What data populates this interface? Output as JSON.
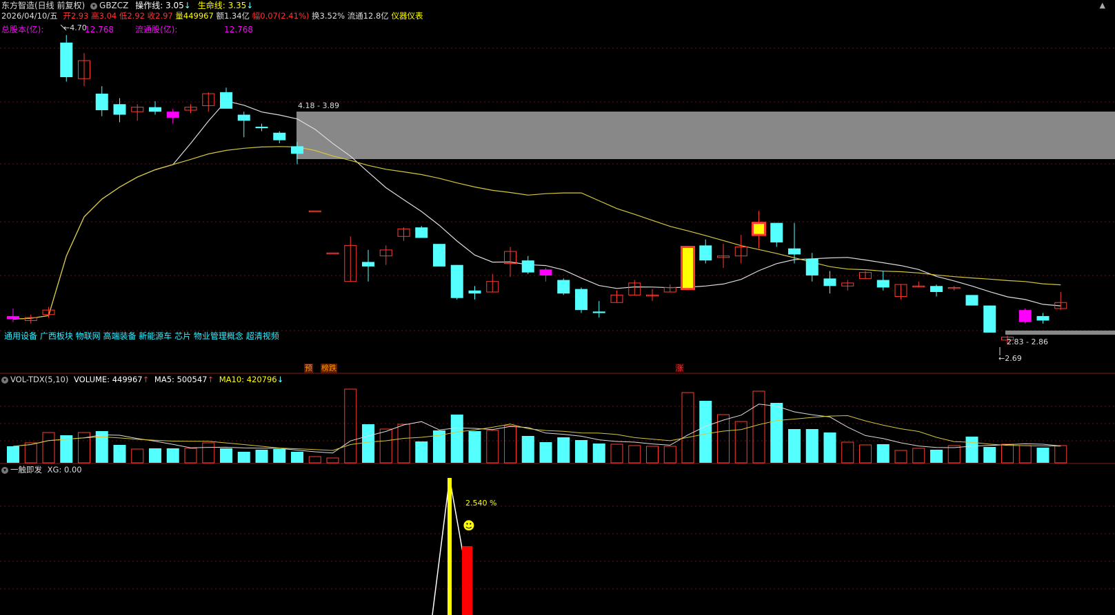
{
  "header": {
    "title": "东方智造(日线 前复权)",
    "code": "GBZCZ",
    "op_line_label": "操作线:",
    "op_line_value": "3.05",
    "op_line_arrow": "↓",
    "life_line_label": "生命线:",
    "life_line_value": "3.35",
    "life_line_arrow": "↓",
    "collapse_icon": "▲"
  },
  "quote": {
    "date": "2026/04/10/五",
    "open_label": "开",
    "open": "2.93",
    "high_label": "高",
    "high": "3.04",
    "low_label": "低",
    "low": "2.92",
    "close_label": "收",
    "close": "2.97",
    "vol_label": "量",
    "vol": "449967",
    "amount_label": "额",
    "amount": "1.34亿",
    "change_label": "幅",
    "change": "0.07(2.41%)",
    "turnover_label": "换",
    "turnover": "3.52%",
    "float_label": "流通",
    "float_mv": "12.8亿",
    "industry": "仪器仪表"
  },
  "shares": {
    "total_label": "总股本(亿):",
    "total": "12.768",
    "float_label": "流通股(亿):",
    "float": "12.768"
  },
  "price_panel": {
    "high_marker": "4.70",
    "zone_upper_label": "4.18 - 3.89",
    "zone_lower_label": "2.83 - 2.86",
    "low_marker": "2.69",
    "concepts": "通用设备 广西板块 物联网 高端装备 新能源车 芯片 物业管理概念 超清视频",
    "tag_pre": "预",
    "tag_rank": "榜跌",
    "tag_up": "涨",
    "candles": [
      [
        2.88,
        2.93,
        2.84,
        2.86
      ],
      [
        2.85,
        2.89,
        2.83,
        2.87
      ],
      [
        2.89,
        2.94,
        2.87,
        2.92
      ],
      [
        4.7,
        4.75,
        4.44,
        4.47
      ],
      [
        4.46,
        4.63,
        4.41,
        4.58
      ],
      [
        4.36,
        4.41,
        4.21,
        4.25
      ],
      [
        4.29,
        4.33,
        4.17,
        4.22
      ],
      [
        4.24,
        4.29,
        4.18,
        4.27
      ],
      [
        4.27,
        4.31,
        4.22,
        4.24
      ],
      [
        4.24,
        4.26,
        4.16,
        4.2
      ],
      [
        4.25,
        4.29,
        4.23,
        4.27
      ],
      [
        4.28,
        4.37,
        4.24,
        4.36
      ],
      [
        4.37,
        4.4,
        4.26,
        4.26
      ],
      [
        4.22,
        4.24,
        4.07,
        4.18
      ],
      [
        4.14,
        4.16,
        4.11,
        4.13
      ],
      [
        4.1,
        4.11,
        4.03,
        4.05
      ],
      [
        4.01,
        4.04,
        3.89,
        3.96
      ],
      [
        3.58,
        3.58,
        3.58,
        3.58
      ],
      [
        3.3,
        3.3,
        3.3,
        3.3
      ],
      [
        3.11,
        3.41,
        3.11,
        3.35
      ],
      [
        3.24,
        3.32,
        3.11,
        3.21
      ],
      [
        3.28,
        3.35,
        3.22,
        3.32
      ],
      [
        3.41,
        3.47,
        3.38,
        3.46
      ],
      [
        3.47,
        3.48,
        3.4,
        3.4
      ],
      [
        3.36,
        3.36,
        3.21,
        3.21
      ],
      [
        3.22,
        3.22,
        2.99,
        3.0
      ],
      [
        3.05,
        3.08,
        2.99,
        3.03
      ],
      [
        3.04,
        3.16,
        3.04,
        3.11
      ],
      [
        3.23,
        3.34,
        3.14,
        3.31
      ],
      [
        3.25,
        3.28,
        3.16,
        3.17
      ],
      [
        3.19,
        3.2,
        3.11,
        3.15
      ],
      [
        3.12,
        3.13,
        3.02,
        3.03
      ],
      [
        3.06,
        3.07,
        2.9,
        2.92
      ],
      [
        2.91,
        2.98,
        2.87,
        2.9
      ],
      [
        2.97,
        3.05,
        2.97,
        3.02
      ],
      [
        3.02,
        3.12,
        3.02,
        3.1
      ],
      [
        3.02,
        3.06,
        2.98,
        3.02
      ],
      [
        3.04,
        3.09,
        3.04,
        3.07
      ],
      [
        3.06,
        3.34,
        3.06,
        3.34
      ],
      [
        3.35,
        3.39,
        3.23,
        3.25
      ],
      [
        3.27,
        3.36,
        3.2,
        3.28
      ],
      [
        3.28,
        3.42,
        3.23,
        3.34
      ],
      [
        3.42,
        3.58,
        3.33,
        3.5
      ],
      [
        3.5,
        3.5,
        3.34,
        3.37
      ],
      [
        3.33,
        3.5,
        3.23,
        3.29
      ],
      [
        3.26,
        3.3,
        3.11,
        3.15
      ],
      [
        3.13,
        3.18,
        3.03,
        3.08
      ],
      [
        3.08,
        3.12,
        3.05,
        3.1
      ],
      [
        3.13,
        3.18,
        3.13,
        3.17
      ],
      [
        3.12,
        3.18,
        3.05,
        3.07
      ],
      [
        3.01,
        3.09,
        2.99,
        3.09
      ],
      [
        3.08,
        3.11,
        3.07,
        3.08
      ],
      [
        3.08,
        3.09,
        3.01,
        3.04
      ],
      [
        3.07,
        3.08,
        3.05,
        3.07
      ],
      [
        3.02,
        3.02,
        2.95,
        2.95
      ],
      [
        2.95,
        2.95,
        2.77,
        2.77
      ],
      [
        2.72,
        2.75,
        2.69,
        2.74
      ],
      [
        2.84,
        2.93,
        2.83,
        2.92
      ],
      [
        2.88,
        2.9,
        2.83,
        2.85
      ],
      [
        2.93,
        3.04,
        2.92,
        2.97
      ]
    ]
  },
  "volume_panel": {
    "indicator": "VOL-TDX(5,10)",
    "volume_label": "VOLUME:",
    "volume": "449967",
    "volume_arrow": "↑",
    "ma5_label": "MA5:",
    "ma5": "500547",
    "ma5_arrow": "↑",
    "ma10_label": "MA10:",
    "ma10": "420796",
    "ma10_arrow": "↓",
    "bars": [
      240,
      290,
      440,
      400,
      440,
      460,
      260,
      200,
      210,
      210,
      210,
      290,
      210,
      160,
      190,
      200,
      160,
      90,
      70,
      1070,
      560,
      490,
      560,
      310,
      470,
      700,
      460,
      470,
      540,
      390,
      300,
      370,
      330,
      280,
      270,
      250,
      240,
      240,
      1020,
      900,
      700,
      600,
      1040,
      870,
      490,
      490,
      440,
      300,
      260,
      270,
      180,
      210,
      190,
      250,
      380,
      230,
      270,
      250,
      220,
      250
    ]
  },
  "signal_panel": {
    "indicator": "一触即发",
    "xg_label": "XG:",
    "xg": "0.00",
    "percent": "2.540 %",
    "smiley": "☻"
  },
  "colors": {
    "up": "#ff3b30",
    "down": "#54ffff",
    "highlight": "#ff00ff",
    "ma_yellow": "#d7c73a",
    "ma_white": "#dddddd",
    "zone_gray": "#888888",
    "signal_yellow": "#ffff00",
    "signal_red": "#ff0000"
  },
  "chart_data": {
    "type": "candlestick",
    "title": "东方智造(日线 前复权)",
    "last_date": "2026/04/10",
    "ohlc_order": [
      "open",
      "high",
      "low",
      "close"
    ],
    "ylim": [
      2.6,
      4.8
    ],
    "volume_ylim": [
      0,
      1100
    ]
  }
}
